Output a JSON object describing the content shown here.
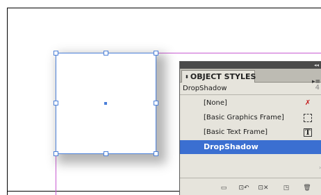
{
  "panel": {
    "collapse_glyph": "◂◂",
    "tab_arrows": "⬍",
    "tab_title": "OBJECT STYLES",
    "menu_glyph": "▸≡",
    "current_style": "DropShadow",
    "current_style_icon": "4"
  },
  "styles": [
    {
      "label": "[None]",
      "icon": "x-icon",
      "glyph": "✗"
    },
    {
      "label": "[Basic Graphics Frame]",
      "icon": "graphics-frame-icon",
      "glyph": ""
    },
    {
      "label": "[Basic Text Frame]",
      "icon": "text-frame-icon",
      "glyph": "T"
    },
    {
      "label": "DropShadow",
      "icon": "",
      "glyph": ""
    }
  ],
  "bottom_bar": {
    "buttons": [
      {
        "name": "new-style-group-button",
        "glyph": "▭"
      },
      {
        "name": "clear-overrides-button",
        "glyph": "⊡↶"
      },
      {
        "name": "clear-attributes-button",
        "glyph": "⊡✕"
      },
      {
        "name": "new-style-button",
        "glyph": "◳"
      },
      {
        "name": "delete-style-button",
        "glyph": "🗑"
      }
    ]
  },
  "colors": {
    "selection": "#4a7fd8",
    "margin_guide": "#c85ad2",
    "selected_row": "#3b6fd1",
    "panel_bg": "#e6e4dc"
  }
}
